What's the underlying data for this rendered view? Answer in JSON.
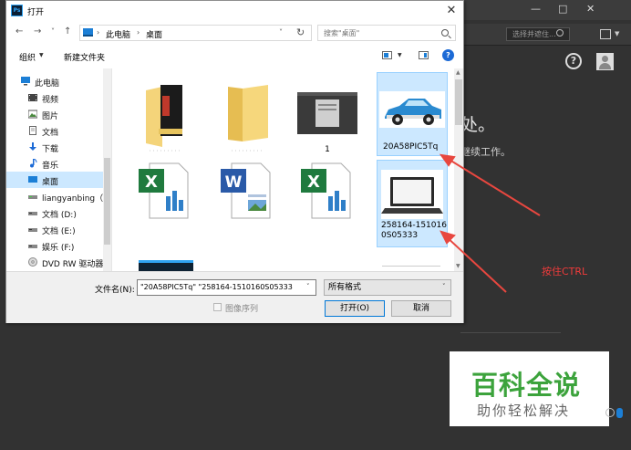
{
  "dialog": {
    "title": "打开",
    "app_icon": "Ps",
    "close_label": "✕"
  },
  "nav": {
    "back": "←",
    "forward": "→",
    "recent": "˅",
    "up": "↑",
    "breadcrumb": [
      "此电脑",
      "桌面"
    ],
    "separator": "›",
    "refresh": "↻",
    "dropdown": "˅"
  },
  "search": {
    "placeholder": "搜索\"桌面\""
  },
  "toolbar": {
    "organize_label": "组织",
    "new_folder_label": "新建文件夹",
    "caret": "▼",
    "help_label": "?"
  },
  "sidebar": {
    "items": [
      {
        "label": "此电脑",
        "icon": "pc-icon"
      },
      {
        "label": "视频",
        "icon": "video-icon"
      },
      {
        "label": "图片",
        "icon": "picture-icon"
      },
      {
        "label": "文档",
        "icon": "document-icon"
      },
      {
        "label": "下载",
        "icon": "download-icon"
      },
      {
        "label": "音乐",
        "icon": "music-icon"
      },
      {
        "label": "桌面",
        "icon": "desktop-icon"
      },
      {
        "label": "liangyanbing（",
        "icon": "drive-icon"
      },
      {
        "label": "文档 (D:)",
        "icon": "drive-icon"
      },
      {
        "label": "文档 (E:)",
        "icon": "drive-icon"
      },
      {
        "label": "娱乐 (F:)",
        "icon": "drive-icon"
      },
      {
        "label": "DVD RW 驱动器",
        "icon": "dvd-icon"
      }
    ]
  },
  "files": [
    {
      "label": "",
      "icon": "folder-with-documents-icon"
    },
    {
      "label": "",
      "icon": "folder-icon"
    },
    {
      "label": "1",
      "icon": "screenshot-thumbnail"
    },
    {
      "label": "20A58PIC5Tq",
      "icon": "car-image-thumbnail",
      "selected": true
    },
    {
      "label": "",
      "icon": "excel-file-icon"
    },
    {
      "label": "",
      "icon": "word-file-icon"
    },
    {
      "label": "",
      "icon": "excel-file-icon"
    },
    {
      "label": "258164-1510160S05333",
      "label_line1": "258164-151016",
      "label_line2": "0S05333",
      "icon": "laptop-image-thumbnail",
      "selected": true
    }
  ],
  "footer": {
    "filename_label": "文件名(N):",
    "filename_value": "\"20A58PIC5Tq\" \"258164-1510160S05333",
    "filetype_value": "所有格式",
    "image_sequence_label": "图像序列",
    "open_label": "打开(O)",
    "cancel_label": "取消",
    "caret": "˅"
  },
  "photoshop": {
    "window_controls": [
      "—",
      "□",
      "✕"
    ],
    "search_placeholder": "选择并遮住...",
    "heading": "处。",
    "subtext": "继续工作。",
    "help_label": "?"
  },
  "annotation": {
    "text": "按住CTRL",
    "color": "#ee3b3b"
  },
  "watermark": {
    "main": "百科全说",
    "sub": "助你轻松解决"
  }
}
